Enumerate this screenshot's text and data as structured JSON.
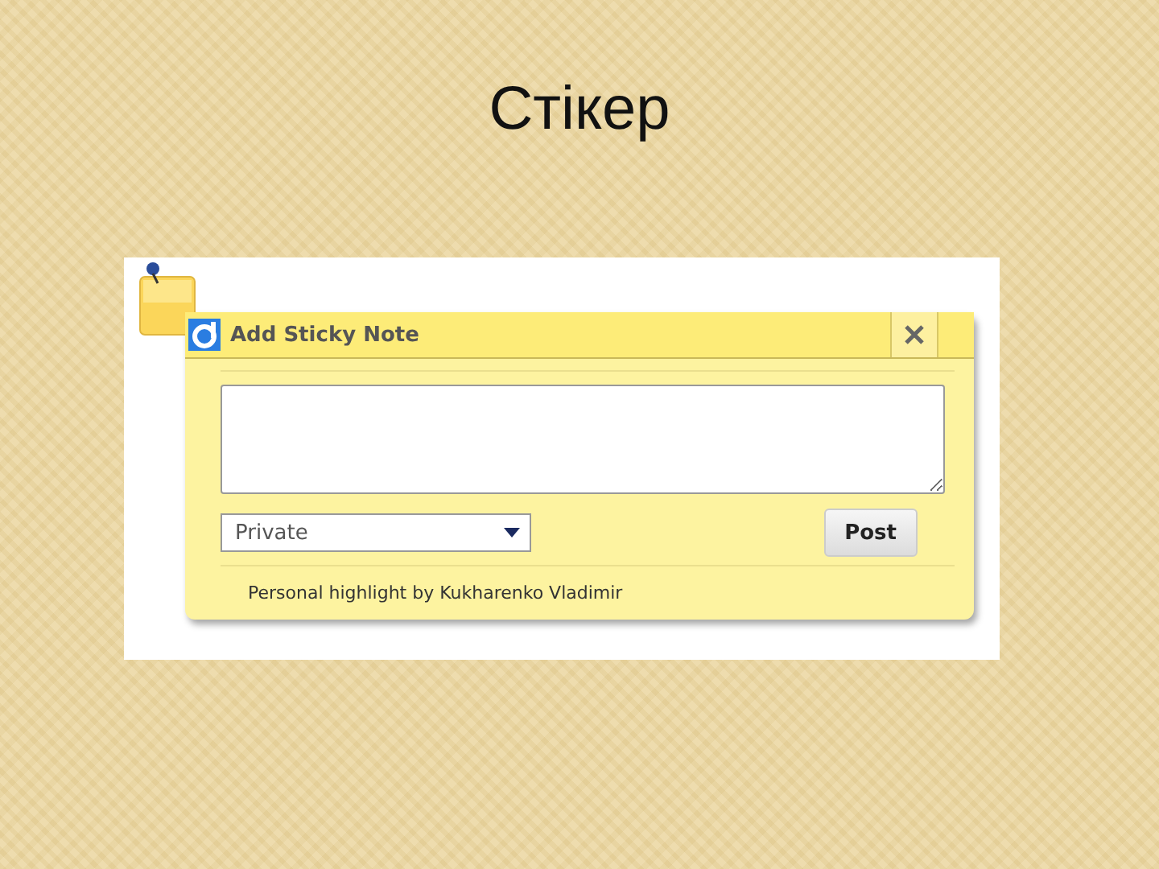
{
  "slide": {
    "title": "Стікер"
  },
  "dialog": {
    "title": "Add Sticky Note",
    "visibility": {
      "value": "Private"
    },
    "post_button": "Post",
    "footer": "Personal highlight by Kukharenko Vladimir"
  }
}
